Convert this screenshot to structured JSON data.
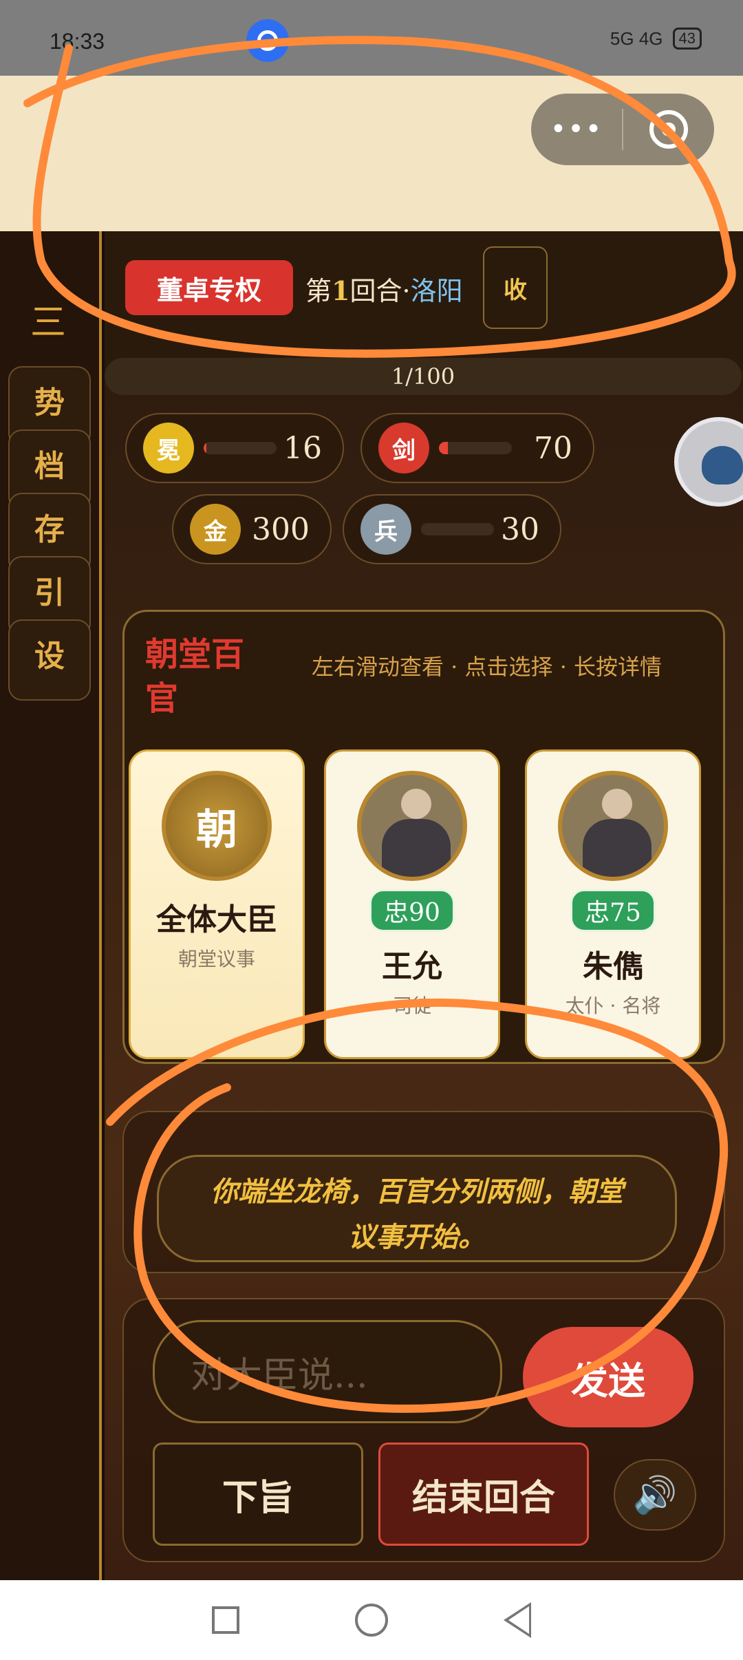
{
  "status_bar": {
    "time": "18:33",
    "network": "5G 4G",
    "battery": "43"
  },
  "capsule": {
    "more_icon": "more-dots-icon",
    "close_icon": "target-icon"
  },
  "sidebar": {
    "menu_icon": "三",
    "items": [
      {
        "label": "势"
      },
      {
        "label": "档"
      },
      {
        "label": "存"
      },
      {
        "label": "引"
      },
      {
        "label": "设"
      }
    ]
  },
  "header": {
    "tag": "董卓专权",
    "round_prefix": "第",
    "round_num": "1",
    "round_suffix": "回合·",
    "city": "洛阳",
    "collapse_label": "收"
  },
  "progress": {
    "text": "1/100",
    "value": 1,
    "max": 100
  },
  "stats": [
    {
      "icon_label": "冕",
      "value": "16",
      "fill": 0.02,
      "color": "#e6b820"
    },
    {
      "icon_label": "剑",
      "value": "70",
      "fill": 0.08,
      "color": "#d83a2e"
    },
    {
      "icon_label": "金",
      "value": "300",
      "color": "#c99520"
    },
    {
      "icon_label": "兵",
      "value": "30",
      "fill": 0.0,
      "color": "#8a9aa6"
    }
  ],
  "court": {
    "title": "朝堂百官",
    "hint": "左右滑动查看 · 点击选择 · 长按详情",
    "cards": [
      {
        "avatar_text": "朝",
        "name": "全体大臣",
        "role": "朝堂议事"
      },
      {
        "loyalty": "忠90",
        "name": "王允",
        "role": "司徒"
      },
      {
        "loyalty": "忠75",
        "name": "朱儁",
        "role": "太仆 · 名将"
      }
    ]
  },
  "narration": "你端坐龙椅，百官分列两侧，朝堂议事开始。",
  "input": {
    "placeholder": "对大臣说...",
    "send_label": "发送"
  },
  "actions": {
    "decree_label": "下旨",
    "end_label": "结束回合",
    "sound_icon": "🔊"
  }
}
